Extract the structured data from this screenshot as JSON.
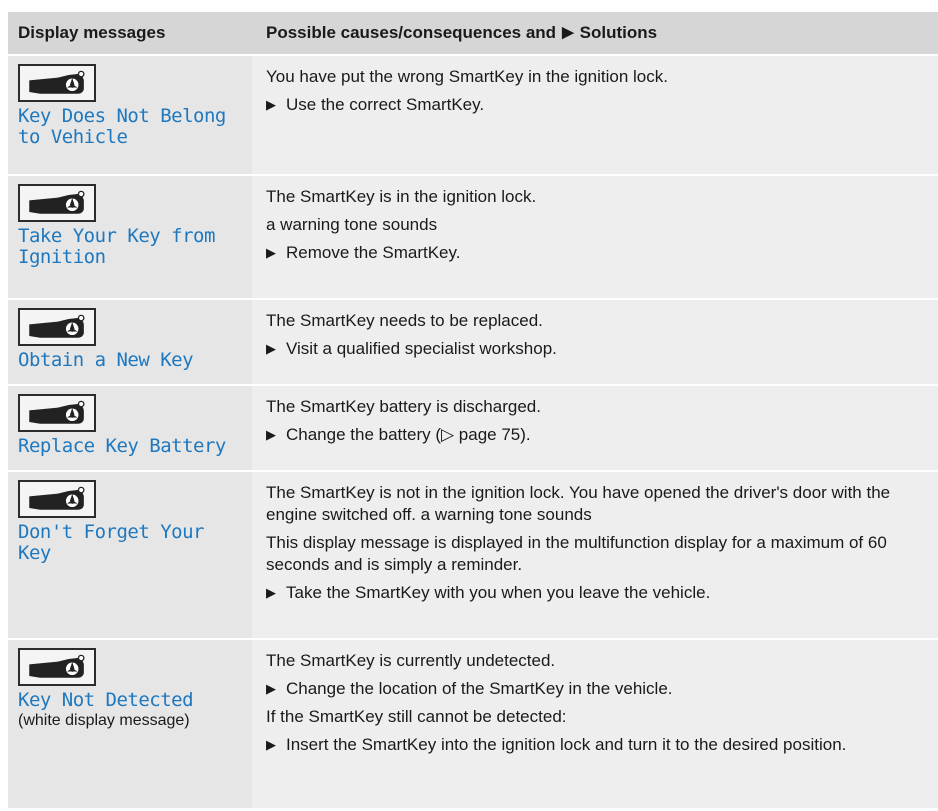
{
  "header": {
    "col1": "Display messages",
    "col2_a": "Possible causes/consequences and",
    "col2_b": "Solutions"
  },
  "rows": [
    {
      "message": "Key Does Not Belong to Vehicle",
      "texts": [
        "You have put the wrong SmartKey in the ignition lock."
      ],
      "steps": [
        "Use the correct SmartKey."
      ]
    },
    {
      "message": "Take Your Key from Ignition",
      "texts": [
        "The SmartKey is in the ignition lock.",
        "a warning tone sounds"
      ],
      "steps": [
        "Remove the SmartKey."
      ]
    },
    {
      "message": "Obtain a New Key",
      "texts": [
        "The SmartKey needs to be replaced."
      ],
      "steps": [
        "Visit a qualified specialist workshop."
      ]
    },
    {
      "message": "Replace Key Battery",
      "texts": [
        "The SmartKey battery is discharged."
      ],
      "steps": [
        "Change the battery (▷ page 75)."
      ]
    },
    {
      "message": "Don't Forget Your Key",
      "texts": [
        "The SmartKey is not in the ignition lock. You have opened the driver's door with the engine switched off. a warning tone sounds",
        "This display message is displayed in the multifunction display for a maximum of 60 seconds and is simply a reminder."
      ],
      "steps": [
        "Take the SmartKey with you when you leave the vehicle."
      ]
    },
    {
      "message": "Key Not Detected",
      "note": "(white display message)",
      "texts": [
        "The SmartKey is currently undetected."
      ],
      "steps": [
        "Change the location of the SmartKey in the vehicle."
      ],
      "texts2": [
        "If the SmartKey still cannot be detected:"
      ],
      "steps2": [
        "Insert the SmartKey into the ignition lock and turn it to the desired position."
      ]
    }
  ],
  "icons": {
    "key": "smartkey-icon",
    "step": "triangle-right-icon"
  },
  "colors": {
    "message": "#1e78bf",
    "header_bg": "#d6d6d6",
    "left_bg": "#e6e6e6",
    "right_bg": "#eeeeee"
  }
}
